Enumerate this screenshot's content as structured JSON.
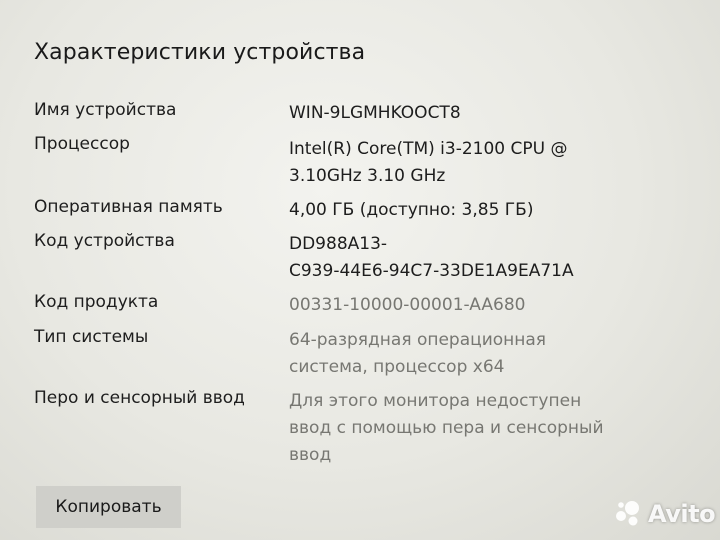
{
  "section_title": "Характеристики устройства",
  "specs": [
    {
      "label": "Имя устройства",
      "value_lines": [
        "WIN-9LGMHKOOCT8"
      ]
    },
    {
      "label": "Процессор",
      "value_lines": [
        "Intel(R) Core(TM) i3-2100 CPU @",
        "3.10GHz   3.10 GHz"
      ]
    },
    {
      "label": "Оперативная память",
      "value_lines": [
        "4,00 ГБ (доступно: 3,85 ГБ)"
      ]
    },
    {
      "label": "Код устройства",
      "value_lines": [
        "DD988A13-",
        "C939-44E6-94C7-33DE1A9EA71A"
      ]
    },
    {
      "label": "Код продукта",
      "value_lines": [
        "00331-10000-00001-AA680"
      ]
    },
    {
      "label": "Тип системы",
      "value_lines": [
        "64-разрядная операционная",
        "система, процессор x64"
      ]
    },
    {
      "label": "Перо и сенсорный ввод",
      "value_lines": [
        "Для этого монитора недоступен",
        "ввод с помощью пера и сенсорный",
        "ввод"
      ]
    }
  ],
  "copy_button_label": "Копировать",
  "watermark": {
    "text": "Avito",
    "icon": "avito-logo-icon"
  }
}
